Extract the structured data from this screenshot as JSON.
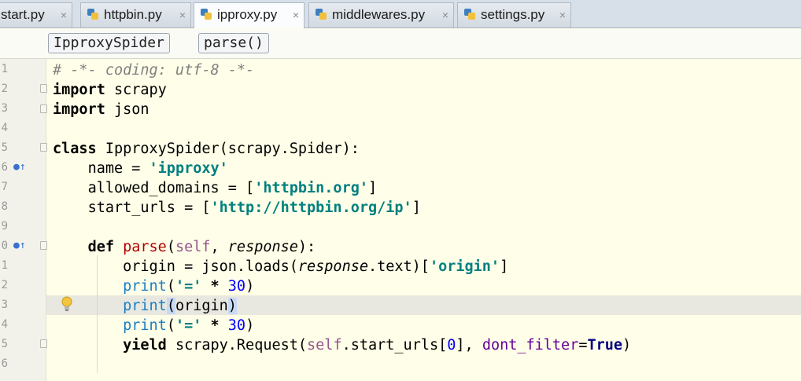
{
  "tabs": [
    {
      "label": "start.py",
      "active": false
    },
    {
      "label": "httpbin.py",
      "active": false
    },
    {
      "label": "ipproxy.py",
      "active": true
    },
    {
      "label": "middlewares.py",
      "active": false
    },
    {
      "label": "settings.py",
      "active": false
    }
  ],
  "tab_close_glyph": "×",
  "breadcrumb": {
    "class_name": "IpproxySpider",
    "method": "parse()"
  },
  "line_numbers": [
    "1",
    "2",
    "3",
    "4",
    "5",
    "6",
    "7",
    "8",
    "9",
    "0",
    "1",
    "2",
    "3",
    "4",
    "5",
    "6"
  ],
  "code": {
    "l1": {
      "comment": "# -*- coding: utf-8 -*-"
    },
    "l2": {
      "kw": "import",
      "rest": " scrapy"
    },
    "l3": {
      "kw": "import",
      "rest": " json"
    },
    "l5": {
      "kw": "class",
      "name": " IpproxySpider",
      "rest": "(scrapy.Spider):"
    },
    "l6": {
      "indent": "    ",
      "pre": "name = ",
      "str": "'ipproxy'"
    },
    "l7": {
      "indent": "    ",
      "pre": "allowed_domains = [",
      "str": "'httpbin.org'",
      "post": "]"
    },
    "l8": {
      "indent": "    ",
      "pre": "start_urls = [",
      "str": "'http://httpbin.org/ip'",
      "post": "]"
    },
    "l10": {
      "indent": "    ",
      "kw": "def",
      "fn": " parse",
      "open": "(",
      "self": "self",
      "comma": ", ",
      "param": "response",
      "close": "):"
    },
    "l11": {
      "indent": "        ",
      "pre": "origin = json.loads(",
      "param": "response",
      "mid": ".text)[",
      "str": "'origin'",
      "post": "]"
    },
    "l12": {
      "indent": "        ",
      "fn": "print",
      "open": "(",
      "str": "'='",
      "op": " * ",
      "num": "30",
      "close": ")"
    },
    "l13": {
      "indent": "        ",
      "fn": "print",
      "open": "(",
      "arg": "origin",
      "close": ")"
    },
    "l14": {
      "indent": "        ",
      "fn": "print",
      "open": "(",
      "str": "'='",
      "op": " * ",
      "num": "30",
      "close": ")"
    },
    "l15": {
      "indent": "        ",
      "kw": "yield",
      "pre": " scrapy.Request(",
      "self": "self",
      "mid": ".start_urls[",
      "num": "0",
      "mid2": "], ",
      "kwarg": "dont_filter",
      "eq": "=",
      "bool": "True",
      "close": ")"
    }
  }
}
